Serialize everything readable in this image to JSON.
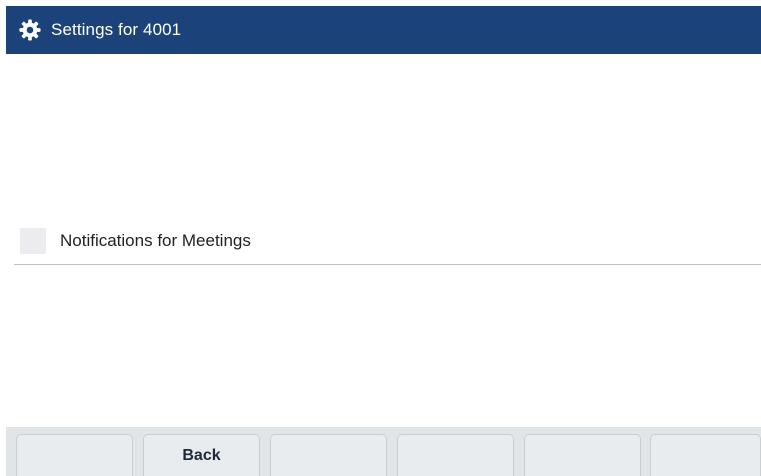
{
  "header": {
    "title": "Settings for 4001",
    "icon": "gear-icon",
    "background_color": "#1b4379"
  },
  "settings_list": {
    "items": [
      {
        "label": "Notifications for Meetings",
        "checked": false
      }
    ]
  },
  "softkeys": {
    "keys": [
      {
        "label": ""
      },
      {
        "label": "Back"
      },
      {
        "label": ""
      },
      {
        "label": ""
      },
      {
        "label": ""
      },
      {
        "label": ""
      }
    ]
  }
}
